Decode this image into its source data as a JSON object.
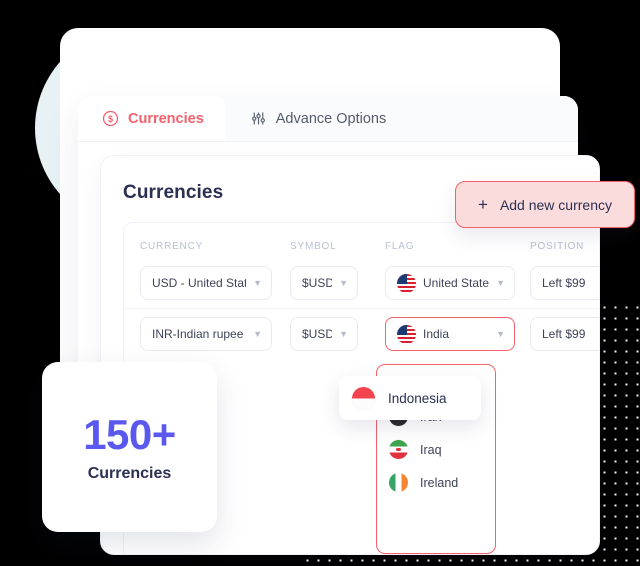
{
  "theme": {
    "accent_red": "#f4606c",
    "accent_purple": "#5b58ef",
    "text_dark": "#2b2f52",
    "button_bg": "#fbdcdd",
    "circle_blue": "#e8f1f4"
  },
  "tabs": [
    {
      "label": "Currencies",
      "icon": "dollar-circle-icon",
      "active": true
    },
    {
      "label": "Advance Options",
      "icon": "sliders-icon",
      "active": false
    }
  ],
  "card": {
    "title": "Currencies",
    "add_button": {
      "label": "Add new currency",
      "icon": "plus-icon"
    },
    "columns": [
      "CURRENCY",
      "SYMBOL",
      "FLAG",
      "POSITION"
    ],
    "rows": [
      {
        "currency": "USD - United State",
        "symbol": "$USD",
        "flag_label": "United States",
        "flag_icon": "flag-us",
        "position": "Left $99",
        "flag_active": false
      },
      {
        "currency": "INR-Indian rupee",
        "symbol": "$USD",
        "flag_label": "India",
        "flag_icon": "flag-us",
        "position": "Left $99",
        "flag_active": true
      }
    ]
  },
  "dropdown": {
    "highlighted": {
      "label": "Indonesia",
      "flag_icon": "flag-id"
    },
    "options": [
      {
        "label": "Iran",
        "flag_icon": "flag-iran"
      },
      {
        "label": "Iraq",
        "flag_icon": "flag-iraq"
      },
      {
        "label": "Ireland",
        "flag_icon": "flag-ie"
      }
    ]
  },
  "stat_card": {
    "number": "150+",
    "label": "Currencies"
  }
}
